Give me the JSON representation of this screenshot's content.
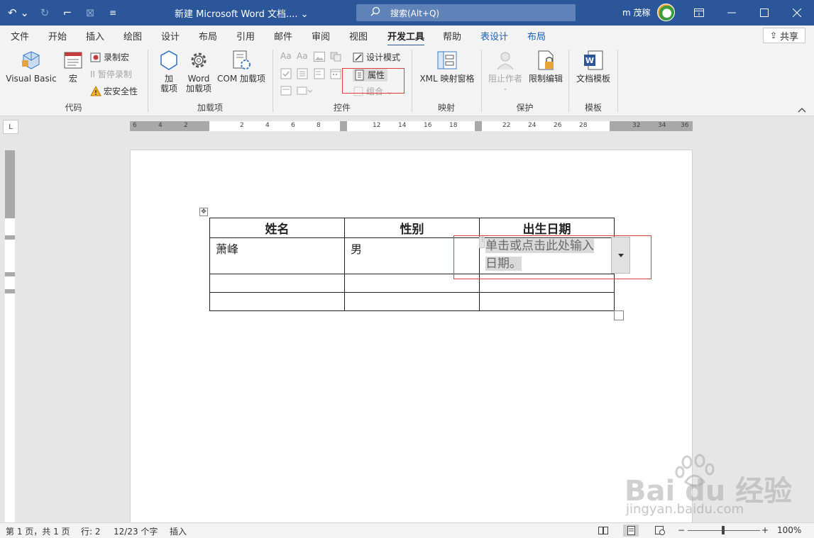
{
  "titlebar": {
    "doc_title": "新建 Microsoft Word 文档.... ⌄",
    "search_text": "搜索(Alt+Q)",
    "user_name": "m 茂稼",
    "undo": "↶ ⌄",
    "redo": "↻",
    "touch": "⌐",
    "dim": "⊠",
    "customize": "≡"
  },
  "tabs": [
    "文件",
    "开始",
    "插入",
    "绘图",
    "设计",
    "布局",
    "引用",
    "邮件",
    "审阅",
    "视图",
    "开发工具",
    "帮助",
    "表设计",
    "布局"
  ],
  "share_label": "共享",
  "ribbon": {
    "code": {
      "label": "代码",
      "visual_basic": "Visual Basic",
      "macro": "宏",
      "record_macro": "录制宏",
      "pause_record": "II 暂停录制",
      "macro_security": "宏安全性"
    },
    "addins": {
      "label": "加载项",
      "addin_l1": "加",
      "addin_l2": "载项",
      "word_addin_l1": "Word",
      "word_addin_l2": "加载项",
      "com_addin": "COM 加载项"
    },
    "controls": {
      "label": "控件",
      "design_mode": "设计模式",
      "properties": "属性",
      "group": "组合 ⌄",
      "aa1": "Aa",
      "aa2": "Aa"
    },
    "mapping": {
      "label": "映射",
      "xml_pane": "XML 映射窗格"
    },
    "protect": {
      "label": "保护",
      "block_authors": "阻止作者",
      "restrict_editing": "限制编辑"
    },
    "templates": {
      "label": "模板",
      "doc_template": "文档模板"
    }
  },
  "ruler": {
    "h_numbers": [
      "6",
      "4",
      "2",
      "2",
      "4",
      "6",
      "8",
      "12",
      "14",
      "16",
      "18",
      "22",
      "24",
      "26",
      "28",
      "32",
      "34",
      "36"
    ],
    "tab_selector": "L"
  },
  "table": {
    "headers": [
      "姓名",
      "性别",
      "出生日期"
    ],
    "rows": [
      [
        "萧峰",
        "男",
        ""
      ],
      [
        "",
        "",
        ""
      ],
      [
        "",
        "",
        ""
      ]
    ],
    "date_placeholder_line1": "单击或点击此处输入",
    "date_placeholder_line2": "日期。"
  },
  "statusbar": {
    "page": "第 1 页，共 1 页",
    "line": "行: 2",
    "words": "12/23 个字",
    "mode": "插入",
    "zoom": "100%"
  },
  "watermark": {
    "text": "Bai du 经验",
    "sub": "jingyan.baidu.com"
  },
  "colors": {
    "accent": "#2b579a",
    "highlight": "#e43d3d"
  }
}
